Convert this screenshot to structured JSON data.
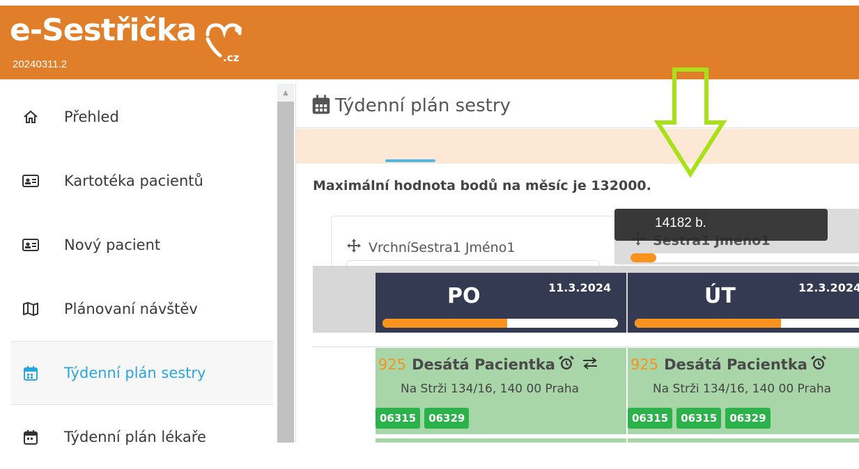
{
  "header": {
    "logo_text": "e-Sestřička",
    "logo_domain": ".cz",
    "version": "20240311.2",
    "color": "#e07e2a"
  },
  "sidebar": {
    "items": [
      {
        "label": "Přehled",
        "icon": "home-icon",
        "active": false
      },
      {
        "label": "Kartotéka pacientů",
        "icon": "id-card-icon",
        "active": false
      },
      {
        "label": "Nový pacient",
        "icon": "id-card-icon",
        "active": false
      },
      {
        "label": "Plánovaní návštěv",
        "icon": "map-icon",
        "active": false
      },
      {
        "label": "Týdenní plán sestry",
        "icon": "calendar-icon",
        "active": true
      },
      {
        "label": "Týdenní plán lékaře",
        "icon": "calendar-icon",
        "active": false
      }
    ],
    "active_color": "#29a6df"
  },
  "main": {
    "page_title": "Týdenní plán sestry",
    "info": "Maximální hodnota bodů na měsíc je 132000.",
    "nurses": [
      {
        "name": "VrchníSestra1 Jméno1"
      },
      {
        "name": "Sestra1 Jméno1",
        "points_tooltip": "14182 b.",
        "progress": 0.11
      }
    ],
    "days": [
      {
        "name": "PO",
        "date": "11.3.2024",
        "progress": 0.53
      },
      {
        "name": "ÚT",
        "date": "12.3.2024",
        "progress": 0.62
      }
    ],
    "visits": [
      {
        "points": "925",
        "patient": "Desátá Pacientka",
        "address": "Na Strži 134/16, 140 00 Praha",
        "codes": [
          "06315",
          "06329"
        ]
      },
      {
        "points": "925",
        "patient": "Desátá Pacientka",
        "address": "Na Strži 134/16, 140 00 Praha",
        "codes": [
          "06315",
          "06315",
          "06329"
        ]
      }
    ]
  },
  "annotation": {
    "arrow_color": "#a8e01a"
  }
}
